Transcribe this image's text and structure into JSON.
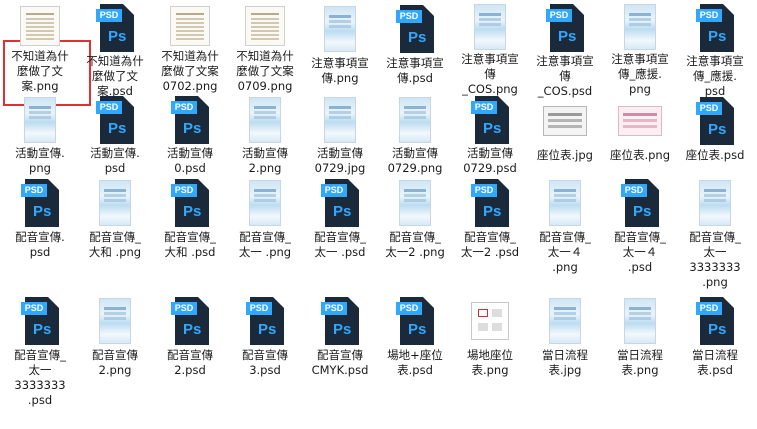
{
  "files": [
    {
      "label": "不知道為什\n麼做了文\n案.png",
      "type": "doc",
      "selected": true
    },
    {
      "label": "不知道為什\n麼做了文\n案.psd",
      "type": "psd"
    },
    {
      "label": "不知道為什\n麼做了文案\n0702.png",
      "type": "doc"
    },
    {
      "label": "不知道為什\n麼做了文案\n0709.png",
      "type": "doc"
    },
    {
      "label": "注意事項宣\n傳.png",
      "type": "poster"
    },
    {
      "label": "注意事項宣\n傳.psd",
      "type": "psd"
    },
    {
      "label": "注意事項宣\n傳\n_COS.png",
      "type": "poster"
    },
    {
      "label": "注意事項宣\n傳\n_COS.psd",
      "type": "psd"
    },
    {
      "label": "注意事項宣\n傳_應援.\npng",
      "type": "poster"
    },
    {
      "label": "注意事項宣\n傳_應援.\npsd",
      "type": "psd"
    },
    {
      "label": "活動宣傳.\npng",
      "type": "poster"
    },
    {
      "label": "活動宣傳.\npsd",
      "type": "psd"
    },
    {
      "label": "活動宣傳\n0.psd",
      "type": "psd"
    },
    {
      "label": "活動宣傳\n2.png",
      "type": "poster"
    },
    {
      "label": "活動宣傳\n0729.jpg",
      "type": "poster"
    },
    {
      "label": "活動宣傳\n0729.png",
      "type": "poster"
    },
    {
      "label": "活動宣傳\n0729.psd",
      "type": "psd"
    },
    {
      "label": "座位表.jpg",
      "type": "seat"
    },
    {
      "label": "座位表.png",
      "type": "seat-pink"
    },
    {
      "label": "座位表.psd",
      "type": "psd"
    },
    {
      "label": "配音宣傳.\npsd",
      "type": "psd"
    },
    {
      "label": "配音宣傳_\n大和 .png",
      "type": "poster"
    },
    {
      "label": "配音宣傳_\n大和 .psd",
      "type": "psd"
    },
    {
      "label": "配音宣傳_\n太一 .png",
      "type": "poster"
    },
    {
      "label": "配音宣傳_\n太一 .psd",
      "type": "psd"
    },
    {
      "label": "配音宣傳_\n太一2 .png",
      "type": "poster"
    },
    {
      "label": "配音宣傳_\n太一2 .psd",
      "type": "psd"
    },
    {
      "label": "配音宣傳_\n太一４\n.png",
      "type": "poster"
    },
    {
      "label": "配音宣傳_\n太一４\n.psd",
      "type": "psd"
    },
    {
      "label": "配音宣傳_\n太一\n3333333\n.png",
      "type": "poster"
    },
    {
      "label": "配音宣傳_\n太一\n3333333\n.psd",
      "type": "psd"
    },
    {
      "label": "配音宣傳\n2.png",
      "type": "poster"
    },
    {
      "label": "配音宣傳\n2.psd",
      "type": "psd"
    },
    {
      "label": "配音宣傳\n3.psd",
      "type": "psd"
    },
    {
      "label": "配音宣傳\nCMYK.psd",
      "type": "psd"
    },
    {
      "label": "場地+座位\n表.psd",
      "type": "psd"
    },
    {
      "label": "場地座位\n表.png",
      "type": "venue"
    },
    {
      "label": "當日流程\n表.jpg",
      "type": "poster"
    },
    {
      "label": "當日流程\n表.png",
      "type": "poster"
    },
    {
      "label": "當日流程\n表.psd",
      "type": "psd"
    }
  ],
  "psd_tag": "PSD",
  "psd_mark": "Ps"
}
